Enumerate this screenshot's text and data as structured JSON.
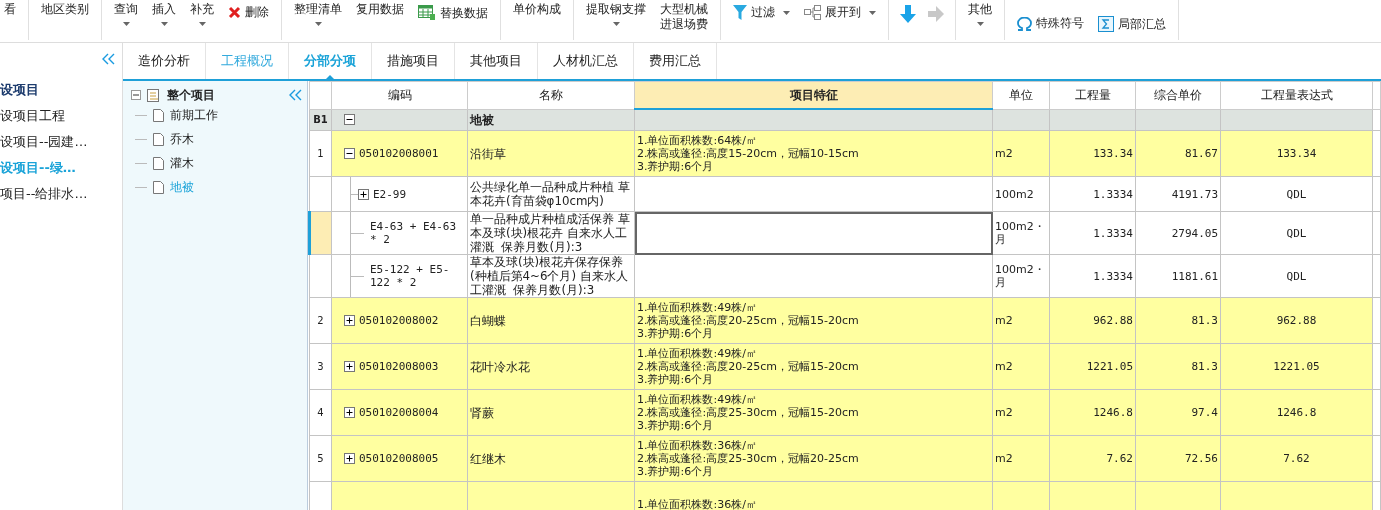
{
  "toolbar": {
    "groups": [
      {
        "items": [
          {
            "kind": "plain",
            "label": "看"
          }
        ]
      },
      {
        "items": [
          {
            "kind": "plain",
            "label": "地区类别"
          }
        ]
      },
      {
        "items": [
          {
            "kind": "dropdown",
            "label": "查询"
          },
          {
            "kind": "dropdown",
            "label": "插入"
          },
          {
            "kind": "dropdown",
            "label": "补充"
          },
          {
            "kind": "delete",
            "label": "删除"
          }
        ]
      },
      {
        "items": [
          {
            "kind": "dropdown",
            "label": "整理清单"
          },
          {
            "kind": "plain",
            "label": "复用数据"
          },
          {
            "kind": "replace",
            "label": "替换数据"
          }
        ]
      },
      {
        "items": [
          {
            "kind": "plain",
            "label": "单价构成"
          }
        ]
      },
      {
        "items": [
          {
            "kind": "dropdown",
            "label": "提取钢支撑"
          },
          {
            "kind": "plain",
            "label": "大型机械进退场费"
          }
        ]
      },
      {
        "items": [
          {
            "kind": "filter",
            "label": "过滤"
          },
          {
            "kind": "expand",
            "label": "展开到"
          }
        ]
      },
      {
        "items": [
          {
            "kind": "down",
            "disabled": false
          },
          {
            "kind": "right",
            "disabled": true
          }
        ]
      },
      {
        "items": [
          {
            "kind": "dropdown",
            "label": "其他"
          }
        ]
      },
      {
        "items": [
          {
            "kind": "symbol",
            "label": "特殊符号"
          },
          {
            "kind": "subtotal",
            "label": "局部汇总"
          }
        ]
      }
    ]
  },
  "project_tree": {
    "label": "设项目",
    "children": [
      {
        "label": "设项目工程",
        "selected": false
      },
      {
        "label": "设项目--园建…",
        "selected": false
      },
      {
        "label": "设项目--绿…",
        "selected": true
      },
      {
        "label": "项目--给排水…",
        "selected": false
      }
    ]
  },
  "tabs": [
    {
      "label": "造价分析",
      "selected": false,
      "visited": false
    },
    {
      "label": "工程概况",
      "selected": false,
      "visited": true
    },
    {
      "label": "分部分项",
      "selected": true,
      "visited": false
    },
    {
      "label": "措施项目",
      "selected": false,
      "visited": false
    },
    {
      "label": "其他项目",
      "selected": false,
      "visited": false
    },
    {
      "label": "人材机汇总",
      "selected": false,
      "visited": false
    },
    {
      "label": "费用汇总",
      "selected": false,
      "visited": false
    }
  ],
  "section_tree": {
    "label": "整个项目",
    "expanded": true,
    "children": [
      {
        "label": "前期工作",
        "selected": false
      },
      {
        "label": "乔木",
        "selected": false
      },
      {
        "label": "灌木",
        "selected": false
      },
      {
        "label": "地被",
        "selected": true
      }
    ]
  },
  "table": {
    "columns": [
      {
        "label": "编码",
        "selected": false
      },
      {
        "label": "名称",
        "selected": false
      },
      {
        "label": "项目特征",
        "selected": true
      },
      {
        "label": "单位",
        "selected": false
      },
      {
        "label": "工程量",
        "selected": false
      },
      {
        "label": "综合单价",
        "selected": false
      },
      {
        "label": "工程量表达式",
        "selected": false
      }
    ],
    "rows": [
      {
        "kind": "section",
        "index": "B1",
        "expanded": true,
        "name": "地被",
        "selected": false
      },
      {
        "kind": "item",
        "index": "1",
        "expanded": true,
        "code": "050102008001",
        "name": "沿街草",
        "features": [
          "1.单位面积株数:64株/㎡",
          "2.株高或蓬径:高度15-20cm，冠幅10-15cm",
          "3.养护期:6个月"
        ],
        "unit": "m2",
        "quantity": "133.34",
        "price": "81.67",
        "expression": "133.34",
        "selected": false
      },
      {
        "kind": "sub",
        "expanded": false,
        "code": "E2-99",
        "name": "公共绿化单一品种成片种植 草本花卉(育苗袋φ10cm内)",
        "unit": "100m2",
        "quantity": "1.3334",
        "price": "4191.73",
        "expression": "QDL",
        "selected": false
      },
      {
        "kind": "sub",
        "code": "E4-63 + E4-63 * 2",
        "name": "单一品种成片种植成活保养 草本及球(块)根花卉 自来水人工灌溉  保养月数(月):3",
        "unit": "100m2・月",
        "quantity": "1.3334",
        "price": "2794.05",
        "expression": "QDL",
        "selected": true
      },
      {
        "kind": "sub",
        "code": "E5-122 + E5-122 * 2",
        "name": "草本及球(块)根花卉保存保养(种植后第4~6个月) 自来水人工灌溉  保养月数(月):3",
        "unit": "100m2・月",
        "quantity": "1.3334",
        "price": "1181.61",
        "expression": "QDL",
        "selected": false
      },
      {
        "kind": "item",
        "index": "2",
        "expanded": false,
        "code": "050102008002",
        "name": "白蝴蝶",
        "features": [
          "1.单位面积株数:49株/㎡",
          "2.株高或蓬径:高度20-25cm，冠幅15-20cm",
          "3.养护期:6个月"
        ],
        "unit": "m2",
        "quantity": "962.88",
        "price": "81.3",
        "expression": "962.88",
        "selected": false
      },
      {
        "kind": "item",
        "index": "3",
        "expanded": false,
        "code": "050102008003",
        "name": "花叶冷水花",
        "features": [
          "1.单位面积株数:49株/㎡",
          "2.株高或蓬径:高度20-25cm，冠幅15-20cm",
          "3.养护期:6个月"
        ],
        "unit": "m2",
        "quantity": "1221.05",
        "price": "81.3",
        "expression": "1221.05",
        "selected": false
      },
      {
        "kind": "item",
        "index": "4",
        "expanded": false,
        "code": "050102008004",
        "name": "肾蕨",
        "features": [
          "1.单位面积株数:49株/㎡",
          "2.株高或蓬径:高度25-30cm，冠幅15-20cm",
          "3.养护期:6个月"
        ],
        "unit": "m2",
        "quantity": "1246.8",
        "price": "97.4",
        "expression": "1246.8",
        "selected": false
      },
      {
        "kind": "item",
        "index": "5",
        "expanded": false,
        "code": "050102008005",
        "name": "红继木",
        "features": [
          "1.单位面积株数:36株/㎡",
          "2.株高或蓬径:高度25-30cm，冠幅20-25cm",
          "3.养护期:6个月"
        ],
        "unit": "m2",
        "quantity": "7.62",
        "price": "72.56",
        "expression": "7.62",
        "selected": false
      },
      {
        "kind": "item",
        "features": [
          "1.单位面积株数:36株/㎡"
        ],
        "selected": false
      }
    ]
  }
}
